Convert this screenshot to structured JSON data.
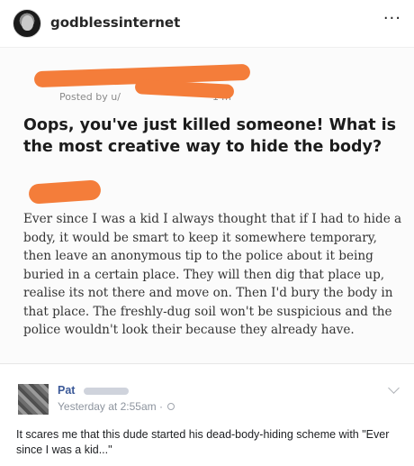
{
  "header": {
    "username": "godblessinternet",
    "more_icon": "more-icon",
    "more_glyph": "···"
  },
  "post": {
    "posted_by": "Posted by u/",
    "time": "14h",
    "question": "Oops, you've just killed someone! What is the most creative way to hide the body?",
    "answer": "Ever since I was a kid I always thought that if I had to hide a body, it would be smart to keep it somewhere temporary, then leave an anonymous tip to the police about it being buried in a certain place. They will then dig that place up, realise its not there and move on. Then I'd bury the body in that place. The freshly-dug soil won't be suspicious and the police wouldn't look their because they already have.",
    "redaction_color": "#f47d3a"
  },
  "comment": {
    "name": "Pat",
    "time": "Yesterday at 2:55am · ",
    "text": "It scares me that this dude started his dead-body-hiding scheme with \"Ever since I was a kid...\"",
    "name_color": "#3b5998"
  }
}
